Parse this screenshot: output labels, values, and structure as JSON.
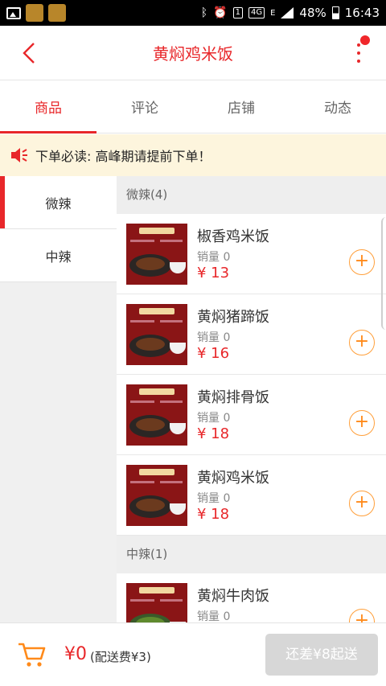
{
  "status_bar": {
    "battery": "48%",
    "time": "16:43",
    "network": "4G",
    "signal_letter": "E",
    "sim_index": "1"
  },
  "header": {
    "title": "黄焖鸡米饭"
  },
  "tabs": [
    {
      "label": "商品",
      "active": true
    },
    {
      "label": "评论",
      "active": false
    },
    {
      "label": "店铺",
      "active": false
    },
    {
      "label": "动态",
      "active": false
    }
  ],
  "notice": {
    "text": "下单必读: 高峰期请提前下单！"
  },
  "categories": [
    {
      "label": "微辣",
      "active": true
    },
    {
      "label": "中辣",
      "active": false
    }
  ],
  "sections": [
    {
      "title": "微辣(4)",
      "items": [
        {
          "name": "椒香鸡米饭",
          "sales": "销量 0",
          "price": "¥ 13"
        },
        {
          "name": "黄焖猪蹄饭",
          "sales": "销量 0",
          "price": "¥ 16"
        },
        {
          "name": "黄焖排骨饭",
          "sales": "销量 0",
          "price": "¥ 18"
        },
        {
          "name": "黄焖鸡米饭",
          "sales": "销量 0",
          "price": "¥ 18"
        }
      ]
    },
    {
      "title": "中辣(1)",
      "items": [
        {
          "name": "黄焖牛肉饭",
          "sales": "销量 0",
          "price": ""
        }
      ]
    }
  ],
  "add_symbol": "+",
  "bottom_bar": {
    "total": "¥0",
    "delivery_fee": "(配送费¥3)",
    "checkout_label": "还差¥8起送"
  },
  "colors": {
    "accent": "#e8272a",
    "add_button": "#ff8a1a",
    "notice_bg": "#fdf5dd"
  }
}
